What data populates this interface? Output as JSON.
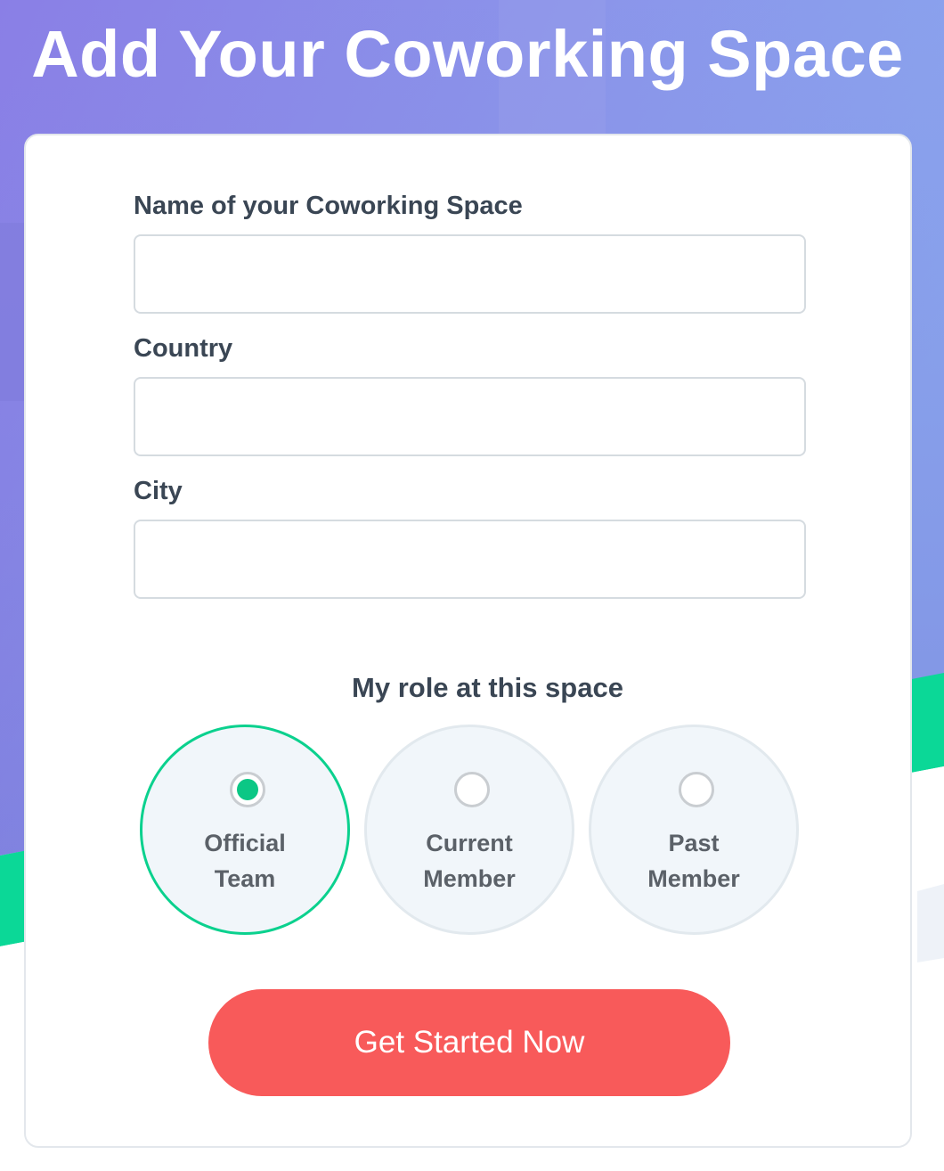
{
  "page": {
    "title": "Add Your Coworking Space"
  },
  "form": {
    "name_label": "Name of your Coworking Space",
    "name_value": "",
    "country_label": "Country",
    "country_value": "",
    "city_label": "City",
    "city_value": ""
  },
  "role": {
    "heading": "My role at this space",
    "selected": "official-team",
    "options": [
      {
        "id": "official-team",
        "line1": "Official",
        "line2": "Team"
      },
      {
        "id": "current-member",
        "line1": "Current",
        "line2": "Member"
      },
      {
        "id": "past-member",
        "line1": "Past",
        "line2": "Member"
      }
    ]
  },
  "cta": {
    "label": "Get Started Now"
  },
  "colors": {
    "hero_gradient_start": "#8c80e8",
    "hero_gradient_end": "#8aa3ee",
    "accent_green": "#0bd18e",
    "cta_red": "#f85a5a",
    "text_dark": "#3a4654"
  }
}
